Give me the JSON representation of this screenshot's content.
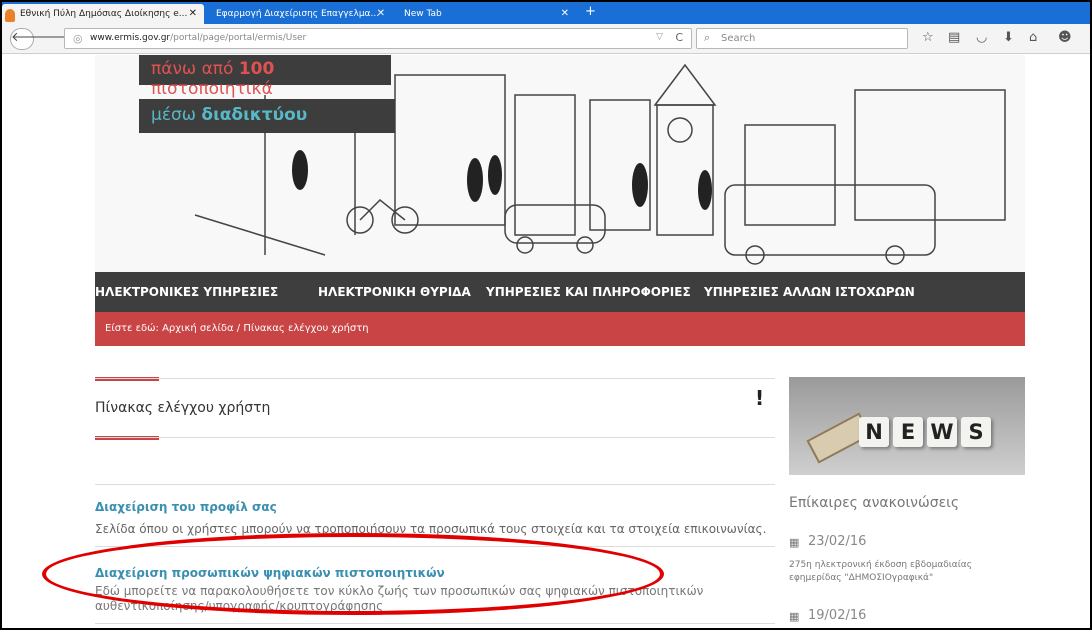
{
  "browser": {
    "tabs": [
      {
        "label": "Εθνική Πύλη Δημόσιας Διοίκησης e..."
      },
      {
        "label": "Εφαρμογή Διαχείρισης Επαγγελμα..."
      },
      {
        "label": "New Tab"
      }
    ],
    "url": {
      "host": "www.ermis.gov.gr",
      "path": "/portal/page/portal/ermis/User"
    },
    "search_placeholder": "Search"
  },
  "hero": {
    "promo_line1_pre": "πάνω από ",
    "promo_line1_bold": "100",
    "promo_line1_post": " πιστοποιητικά",
    "promo_line2_pre": "μέσω ",
    "promo_line2_bold": "διαδικτύου"
  },
  "menu": {
    "items": [
      {
        "label": "ΗΛΕΚΤΡΟΝΙΚΕΣ ΥΠΗΡΕΣΙΕΣ"
      },
      {
        "label": "ΗΛΕΚΤΡΟΝΙΚΗ ΘΥΡΙΔΑ"
      },
      {
        "label": "ΥΠΗΡΕΣΙΕΣ ΚΑΙ ΠΛΗΡΟΦΟΡΙΕΣ"
      },
      {
        "label": "ΥΠΗΡΕΣΙΕΣ ΑΛΛΩΝ ΙΣΤΟΧΩΡΩΝ"
      }
    ]
  },
  "breadcrumb": "Είστε εδώ: Αρχική σελίδα / Πίνακας ελέγχου χρήστη",
  "main": {
    "title": "Πίνακας ελέγχου χρήστη",
    "alert": "!",
    "items": [
      {
        "link": "Διαχείριση του προφίλ σας",
        "description": "Σελίδα όπου οι χρήστες μπορούν να τροποποιήσουν τα προσωπικά τους στοιχεία και τα στοιχεία επικοινωνίας."
      },
      {
        "link": "Διαχείριση προσωπικών ψηφιακών πιστοποιητικών",
        "description": "Εδώ μπορείτε να παρακολουθήσετε τον κύκλο ζωής των προσωπικών σας ψηφιακών πιστοποιητικών αυθεντικοποίησης/υπογραφής/κρυπτογράφησης"
      }
    ]
  },
  "sidebar": {
    "news_letters": [
      "N",
      "E",
      "W",
      "S"
    ],
    "heading": "Επίκαιρες ανακοινώσεις",
    "news": [
      {
        "date": "23/02/16",
        "text": "275η ηλεκτρονική έκδοση εβδομαδιαίας εφημερίδας \"ΔΗΜΟΣΙΟγραφικά\""
      },
      {
        "date": "19/02/16",
        "text": ""
      }
    ]
  },
  "colors": {
    "accent_red": "#c94545",
    "link_blue": "#3b8fb1",
    "menu_dark": "#3e3e3e",
    "highlight_oval": "#e00000"
  }
}
